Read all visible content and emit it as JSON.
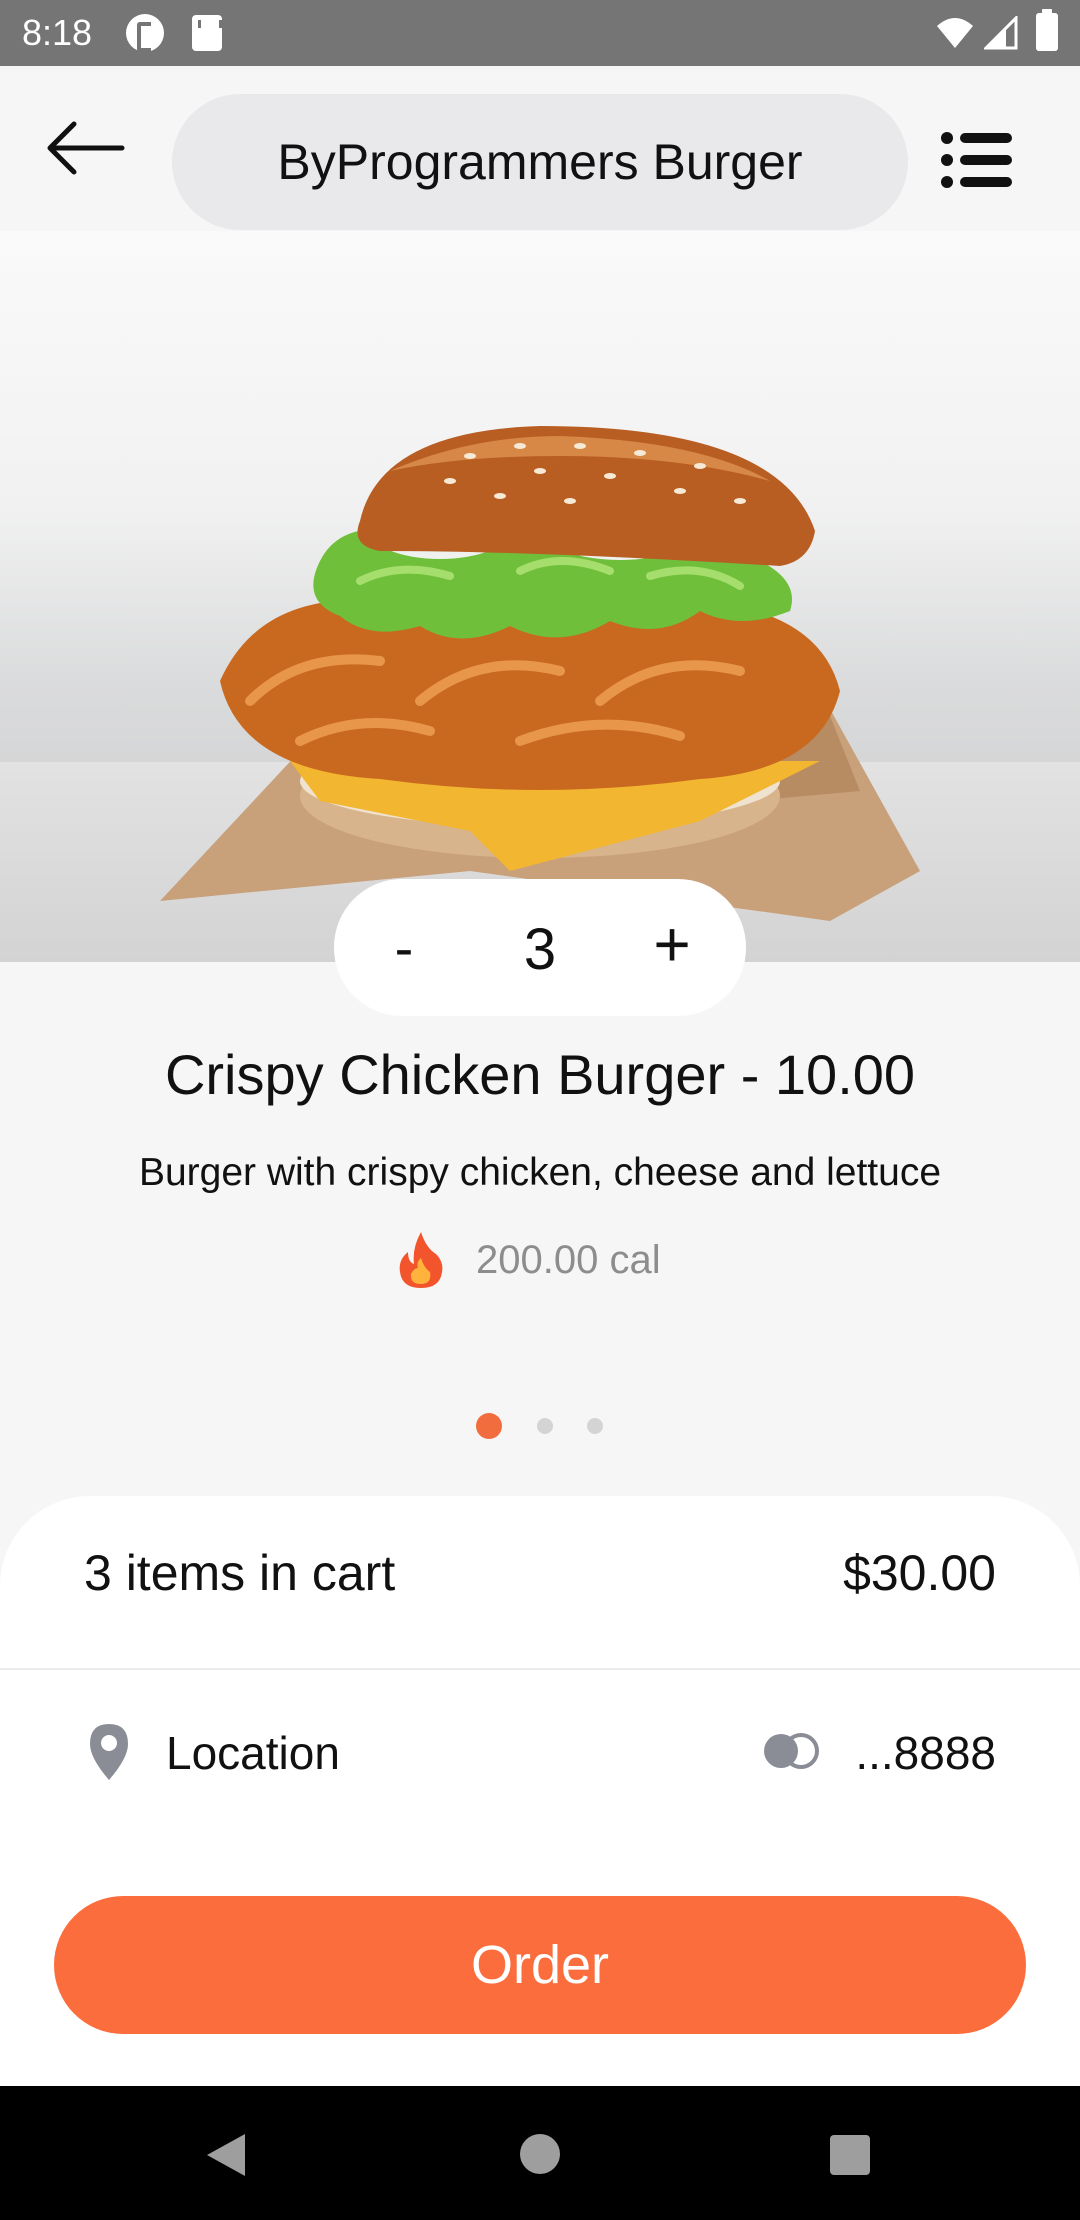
{
  "status_bar": {
    "time": "8:18"
  },
  "header": {
    "title": "ByProgrammers Burger",
    "back_icon": "arrow-left-icon",
    "menu_icon": "list-icon"
  },
  "product": {
    "quantity": "3",
    "minus_label": "-",
    "plus_label": "+",
    "title": "Crispy Chicken Burger - 10.00",
    "description": "Burger with crispy chicken, cheese and lettuce",
    "calories": "200.00 cal",
    "calorie_icon": "fire-icon"
  },
  "pager": {
    "count": 3,
    "active_index": 0
  },
  "cart": {
    "items_label": "3 items in cart",
    "total": "$30.00",
    "location_label": "Location",
    "location_icon": "map-pin-icon",
    "card_icon": "credit-card-icon",
    "card_number": "...8888",
    "order_label": "Order"
  },
  "colors": {
    "accent": "#fb6d3d",
    "pill": "#e9e9ec",
    "background": "#f6f6f6"
  }
}
